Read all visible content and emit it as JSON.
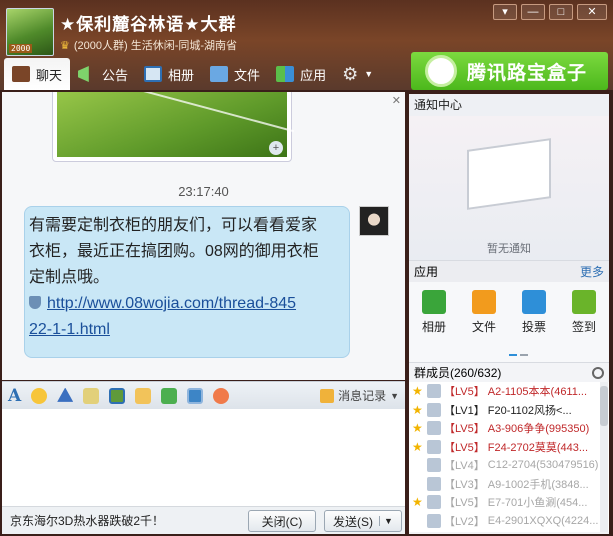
{
  "window": {
    "group_name": "★保利麓谷林语★大群",
    "group_info": "(2000人群) 生活休闲-同城-湖南省",
    "avatar_badge": "2000"
  },
  "tabs": [
    {
      "label": "聊天",
      "active": true
    },
    {
      "label": "公告"
    },
    {
      "label": "相册"
    },
    {
      "label": "文件"
    },
    {
      "label": "应用"
    }
  ],
  "ad_banner": {
    "text": "腾讯路宝盒子"
  },
  "chat": {
    "timestamp": "23:17:40",
    "message_lines": [
      "有需要定制衣柜的朋友们，可以看看爱家",
      "衣柜，最近正在搞团购。08网的御用衣柜",
      "定制点哦。"
    ],
    "link_line1": "http://www.08wojia.com/thread-845",
    "link_line2": "22-1-1.html"
  },
  "input_toolbar": {
    "history_label": "消息记录"
  },
  "bottom": {
    "ad_text": "京东海尔3D热水器跌破2千！",
    "close_label": "关闭(C)",
    "send_label": "发送(S)"
  },
  "right_panel": {
    "notice_title": "通知中心",
    "no_notice": "暂无通知",
    "apps_title": "应用",
    "apps_more": "更多",
    "apps": [
      {
        "label": "相册",
        "icon": "photo-icon"
      },
      {
        "label": "文件",
        "icon": "folder-icon"
      },
      {
        "label": "投票",
        "icon": "vote-icon"
      },
      {
        "label": "签到",
        "icon": "checkin-icon"
      }
    ],
    "members_title": "群成员(260/632)",
    "members": [
      {
        "star": true,
        "level": "【LV5】",
        "name": "A2-1105本本(4611...",
        "style": "red"
      },
      {
        "star": true,
        "level": "【LV1】",
        "name": "F20-1102风扬<...",
        "style": "dark"
      },
      {
        "star": true,
        "level": "【LV5】",
        "name": "A3-906争争(995350)",
        "style": "red"
      },
      {
        "star": true,
        "level": "【LV5】",
        "name": "F24-2702莫莫(443...",
        "style": "red"
      },
      {
        "star": false,
        "level": "【LV4】",
        "name": "C12-2704(530479516)",
        "style": "gray"
      },
      {
        "star": false,
        "level": "【LV3】",
        "name": "A9-1002手机(3848...",
        "style": "gray"
      },
      {
        "star": true,
        "level": "【LV5】",
        "name": "E7-701小鱼涮(454...",
        "style": "gray"
      },
      {
        "star": false,
        "level": "【LV2】",
        "name": "E4-2901XQXQ(4224...",
        "style": "gray"
      }
    ]
  }
}
